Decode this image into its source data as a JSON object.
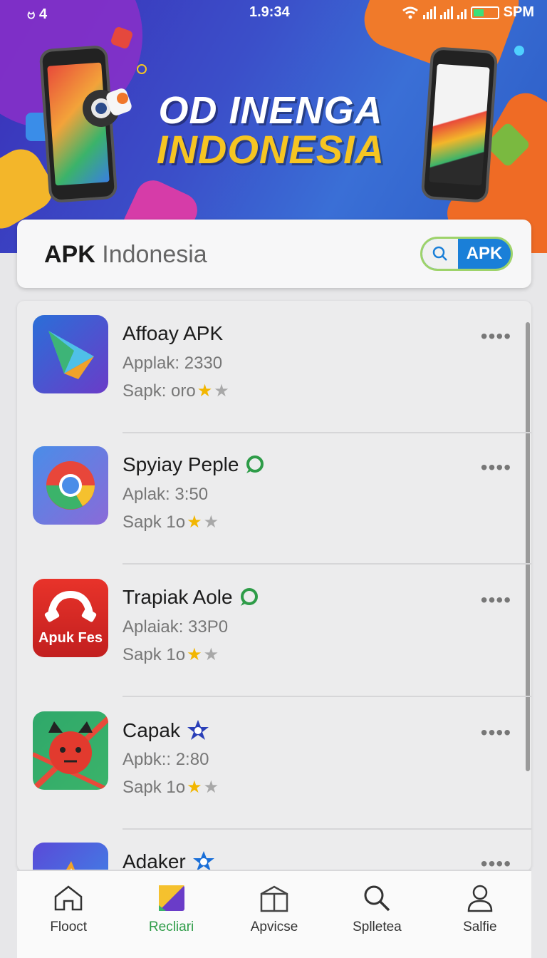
{
  "status_bar": {
    "left": "ဗ 4",
    "time": "1.9:34",
    "right": "SPM"
  },
  "hero": {
    "title_line1": "OD INENGA",
    "title_line2": "INDONESIA"
  },
  "search": {
    "title_bold": "APK",
    "title_rest": " Indonesia",
    "button_label": "APK"
  },
  "apps": [
    {
      "name": "Affoay APK",
      "line1": "Applak: 2330",
      "line2": "Sapk: oro",
      "badge": "",
      "rating_filled": 1,
      "rating_total": 2
    },
    {
      "name": "Spyiay Peple",
      "line1": "Aplak: 3:50",
      "line2": "Sapk 1o",
      "badge": "chat",
      "rating_filled": 1,
      "rating_total": 2
    },
    {
      "name": "Trapiak Aole",
      "line1": "Aplaiak: 33P0",
      "line2": "Sapk 1o",
      "badge": "chat",
      "rating_filled": 1,
      "rating_total": 2,
      "icon_text": "Apuk Fes"
    },
    {
      "name": "Capak",
      "line1": "Apbk:: 2:80",
      "line2": "Sapk 1o",
      "badge": "star",
      "rating_filled": 1,
      "rating_total": 2
    },
    {
      "name": "Adaker",
      "line1": "",
      "line2": "",
      "badge": "star"
    }
  ],
  "more_label": "••••",
  "nav": [
    {
      "label": "Flooct",
      "icon": "home-icon"
    },
    {
      "label": "Recliari",
      "icon": "apps-icon"
    },
    {
      "label": "Apvicse",
      "icon": "store-icon"
    },
    {
      "label": "Splletea",
      "icon": "search-icon"
    },
    {
      "label": "Salfie",
      "icon": "profile-icon"
    }
  ],
  "colors": {
    "accent_green": "#2e9c48",
    "pill_blue": "#1a7fd8",
    "title_gold": "#f6c522"
  }
}
